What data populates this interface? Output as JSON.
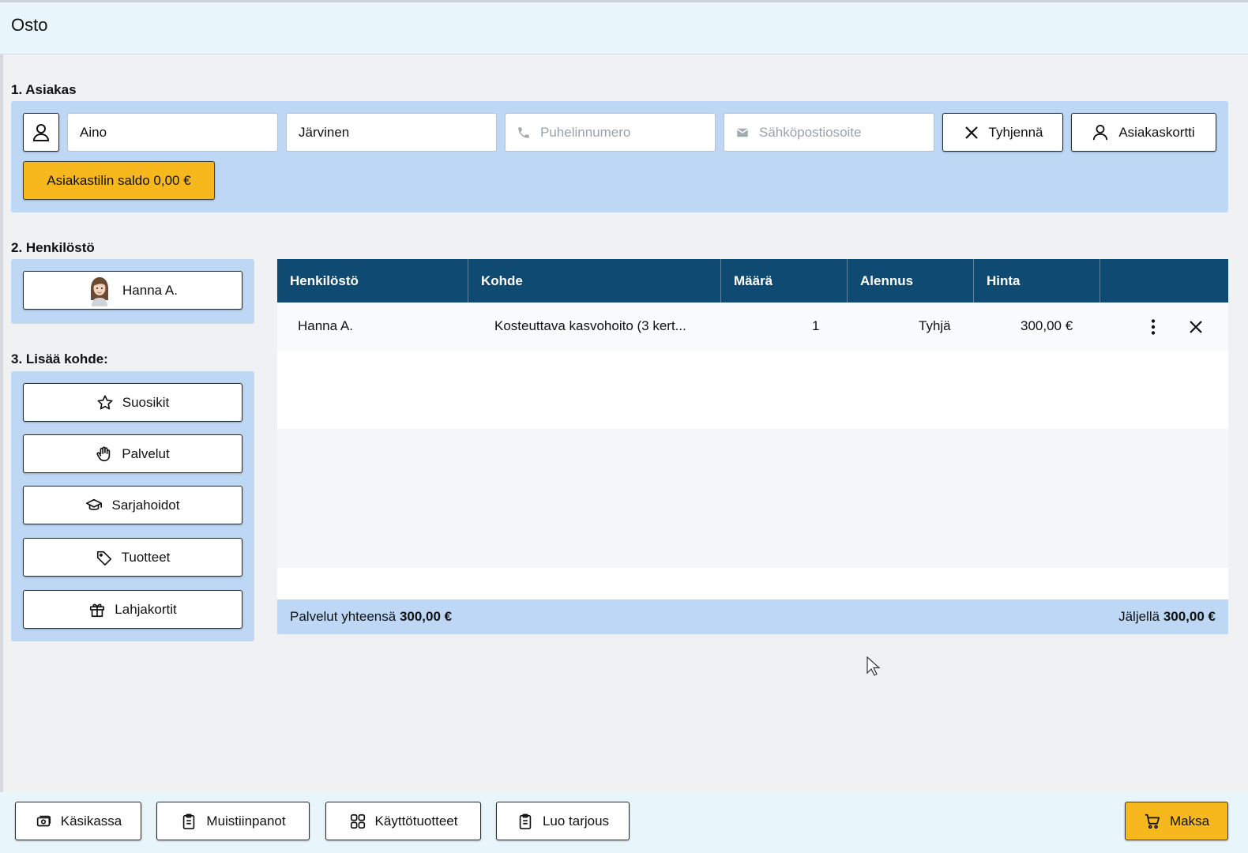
{
  "window": {
    "title": "Osto"
  },
  "customer": {
    "section_label": "1. Asiakas",
    "first_name": "Aino",
    "last_name": "Järvinen",
    "phone_placeholder": "Puhelinnumero",
    "email_placeholder": "Sähköpostiosoite",
    "clear_label": "Tyhjennä",
    "card_label": "Asiakaskortti",
    "balance_label": "Asiakastilin saldo 0,00 €"
  },
  "staff": {
    "section_label": "2. Henkilöstö",
    "selected_name": "Hanna A."
  },
  "add_item": {
    "section_label": "3. Lisää kohde:",
    "buttons": [
      {
        "label": "Suosikit",
        "icon": "star-icon"
      },
      {
        "label": "Palvelut",
        "icon": "hand-icon"
      },
      {
        "label": "Sarjahoidot",
        "icon": "graduation-cap-icon"
      },
      {
        "label": "Tuotteet",
        "icon": "tag-icon"
      },
      {
        "label": "Lahjakortit",
        "icon": "gift-icon"
      }
    ]
  },
  "table": {
    "columns": [
      "Henkilöstö",
      "Kohde",
      "Määrä",
      "Alennus",
      "Hinta",
      ""
    ],
    "rows": [
      {
        "staff": "Hanna A.",
        "item": "Kosteuttava kasvohoito (3 kert...",
        "quantity": "1",
        "discount": "Tyhjä",
        "price": "300,00 €"
      }
    ],
    "footer": {
      "total_label": "Palvelut yhteensä",
      "total_value": "300,00 €",
      "remaining_label": "Jäljellä",
      "remaining_value": "300,00 €"
    }
  },
  "bottom": {
    "cash_label": "Käsikassa",
    "notes_label": "Muistiinpanot",
    "consumables_label": "Käyttötuotteet",
    "offer_label": "Luo tarjous",
    "pay_label": "Maksa"
  },
  "colors": {
    "panel": "#bdd7f5",
    "header": "#0f4a72",
    "accent_yellow": "#f6b81d",
    "topbar": "#e8f5fb"
  }
}
